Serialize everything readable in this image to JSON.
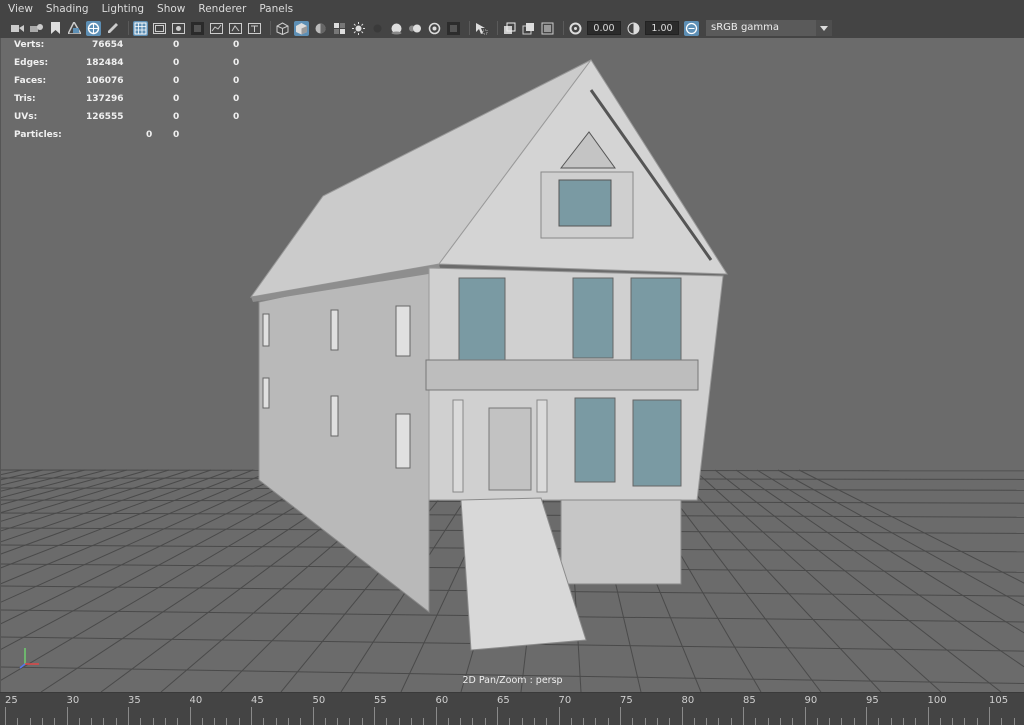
{
  "menu": [
    "View",
    "Shading",
    "Lighting",
    "Show",
    "Renderer",
    "Panels"
  ],
  "toolbar": {
    "icons_group1": [
      "camera-icon",
      "camera-attributes-icon",
      "bookmark-icon",
      "image-plane-icon",
      "grid-toggle-icon",
      "pencil-icon"
    ],
    "icons_group2": [
      "wireframe-icon",
      "film-gate-icon",
      "resolution-gate-icon",
      "gate-mask-icon",
      "field-chart-icon",
      "safe-action-icon",
      "safe-title-icon"
    ],
    "icons_group3": [
      "wireframe-shading-icon",
      "smooth-shade-icon",
      "use-default-material-icon",
      "textured-icon",
      "lights-icon",
      "shadows-icon",
      "screen-space-ao-icon",
      "motion-blur-icon",
      "multisample-aa-icon",
      "depth-of-field-icon",
      "isolate-select-icon"
    ],
    "icons_group4": [
      "xray-icon",
      "xray-joints-icon",
      "backface-culling-icon"
    ],
    "exposure_value": "0.00",
    "gamma_value": "1.00",
    "color_space": "sRGB gamma"
  },
  "hud": {
    "rows": [
      {
        "label": "Verts:",
        "a": "76654",
        "b": "0",
        "c": "0"
      },
      {
        "label": "Edges:",
        "a": "182484",
        "b": "0",
        "c": "0"
      },
      {
        "label": "Faces:",
        "a": "106076",
        "b": "0",
        "c": "0"
      },
      {
        "label": "Tris:",
        "a": "137296",
        "b": "0",
        "c": "0"
      },
      {
        "label": "UVs:",
        "a": "126555",
        "b": "0",
        "c": "0"
      }
    ],
    "particles": {
      "label": "Particles:",
      "a": "0",
      "b": "0"
    }
  },
  "camera_label": "2D Pan/Zoom : persp",
  "timeline": {
    "labels": [
      "25",
      "30",
      "35",
      "40",
      "45",
      "50",
      "55",
      "60",
      "65",
      "70",
      "75",
      "80",
      "85",
      "90",
      "95",
      "100",
      "105"
    ]
  },
  "colors": {
    "viewport_bg": "#6b6b6b",
    "ui_bg": "#444444",
    "accent": "#5d8fb5",
    "model": "#c8c8c8",
    "glass": "#7a9aa3"
  }
}
